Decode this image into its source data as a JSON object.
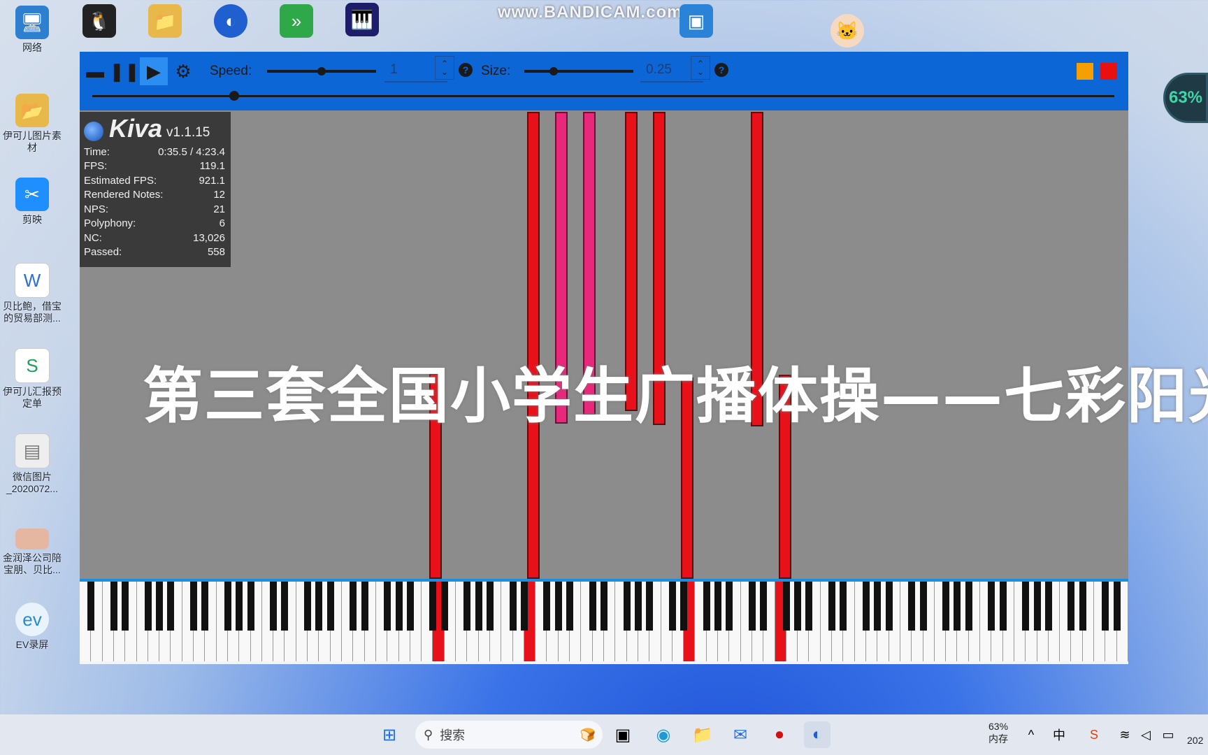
{
  "watermark": "www.BANDICAM.com",
  "gauge": "63%",
  "desktop_icons": [
    {
      "label": "网络",
      "icon": "network-icon",
      "color": "#2f7fd0"
    },
    {
      "label": "伊可儿图片素材",
      "icon": "folder-icon",
      "color": "#e8b84a"
    },
    {
      "label": "剪映",
      "icon": "capcut-icon",
      "color": "#1f8fff"
    },
    {
      "label": "贝比鲍，借宝的贸易部测...",
      "icon": "word-doc-icon",
      "color": "#2b6fd8"
    },
    {
      "label": "伊可儿汇报预定单",
      "icon": "sheet-doc-icon",
      "color": "#1aa15a"
    },
    {
      "label": "微信图片_2020072...",
      "icon": "image-file-icon",
      "color": "#d9d9d9"
    },
    {
      "label": "金润泽公司陪宝朋、贝比...",
      "icon": "photo-icon",
      "color": "#e6b7a0"
    },
    {
      "label": "EV录屏",
      "icon": "ev-recorder-icon",
      "color": "#6fb7e8"
    }
  ],
  "toolbar": {
    "speed_label": "Speed:",
    "speed_value": "1",
    "size_label": "Size:",
    "size_value": "0.25"
  },
  "stats": {
    "title": "Kiva",
    "version": "v1.1.15",
    "rows": [
      {
        "label": "Time:",
        "value": "0:35.5 / 4:23.4"
      },
      {
        "label": "FPS:",
        "value": "119.1"
      },
      {
        "label": "Estimated FPS:",
        "value": "921.1"
      },
      {
        "label": "Rendered Notes:",
        "value": "12"
      },
      {
        "label": "NPS:",
        "value": "21"
      },
      {
        "label": "Polyphony:",
        "value": "6"
      },
      {
        "label": "NC:",
        "value": "13,026"
      },
      {
        "label": "Passed:",
        "value": "558"
      }
    ]
  },
  "caption": "第三套全国小学生广播体操——七彩阳光",
  "taskbar": {
    "search_placeholder": "搜索",
    "memory_percent": "63%",
    "memory_label": "内存",
    "ime": "中",
    "year_partial": "202"
  },
  "colors": {
    "toolbar": "#0d66d6",
    "note": "#e8111a",
    "note_alt": "#e8287a",
    "orange": "#f5a000",
    "red": "#e81010"
  }
}
